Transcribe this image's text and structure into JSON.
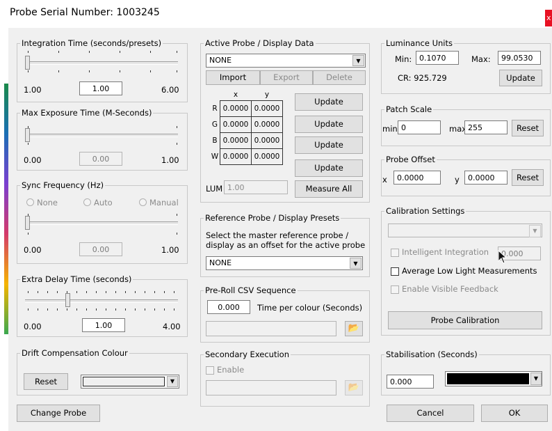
{
  "window": {
    "title": "Probe Serial Number: 1003245",
    "close": "x"
  },
  "integration": {
    "legend": "Integration Time (seconds/presets)",
    "min": "1.00",
    "value": "1.00",
    "max": "6.00"
  },
  "exposure": {
    "legend": "Max Exposure Time (M-Seconds)",
    "min": "0.00",
    "value": "0.00",
    "max": "1.00"
  },
  "sync": {
    "legend": "Sync Frequency (Hz)",
    "opt_none": "None",
    "opt_auto": "Auto",
    "opt_manual": "Manual",
    "min": "0.00",
    "value": "0.00",
    "max": "1.00"
  },
  "delay": {
    "legend": "Extra Delay Time (seconds)",
    "min": "0.00",
    "value": "1.00",
    "max": "4.00"
  },
  "drift": {
    "legend": "Drift Compensation Colour",
    "reset": "Reset"
  },
  "change_probe": "Change Probe",
  "active": {
    "legend": "Active Probe / Display Data",
    "selected": "NONE",
    "import": "Import",
    "export": "Export",
    "delete": "Delete",
    "col_x": "x",
    "col_y": "y",
    "rows": [
      {
        "label": "R",
        "x": "0.0000",
        "y": "0.0000",
        "btn": "Update"
      },
      {
        "label": "G",
        "x": "0.0000",
        "y": "0.0000",
        "btn": "Update"
      },
      {
        "label": "B",
        "x": "0.0000",
        "y": "0.0000",
        "btn": "Update"
      },
      {
        "label": "W",
        "x": "0.0000",
        "y": "0.0000",
        "btn": "Update"
      }
    ],
    "lum_label": "LUM",
    "lum_value": "1.00",
    "measure_all": "Measure All"
  },
  "reference": {
    "legend": "Reference Probe / Display Presets",
    "desc1": "Select the master reference probe /",
    "desc2": "display as an offset for the active probe",
    "selected": "NONE"
  },
  "preroll": {
    "legend": "Pre-Roll CSV Sequence",
    "value": "0.000",
    "label": "Time per colour (Seconds)"
  },
  "secondary": {
    "legend": "Secondary Execution",
    "enable": "Enable"
  },
  "luminance": {
    "legend": "Luminance Units",
    "min_label": "Min:",
    "min": "0.1070",
    "max_label": "Max:",
    "max": "99.0530",
    "cr": "CR: 925.729",
    "update": "Update"
  },
  "patch": {
    "legend": "Patch Scale",
    "min_label": "min",
    "min": "0",
    "max_label": "max",
    "max": "255",
    "reset": "Reset"
  },
  "offset": {
    "legend": "Probe Offset",
    "x_label": "x",
    "x": "0.0000",
    "y_label": "y",
    "y": "0.0000",
    "reset": "Reset"
  },
  "calibration": {
    "legend": "Calibration Settings",
    "intelligent": "Intelligent Integration",
    "intelligent_value": "0.000",
    "average_low": "Average Low Light Measurements",
    "visible_feedback": "Enable Visible Feedback",
    "button": "Probe Calibration"
  },
  "stabilisation": {
    "legend": "Stabilisation (Seconds)",
    "value": "0.000",
    "colour": "#000000"
  },
  "cancel": "Cancel",
  "ok": "OK"
}
